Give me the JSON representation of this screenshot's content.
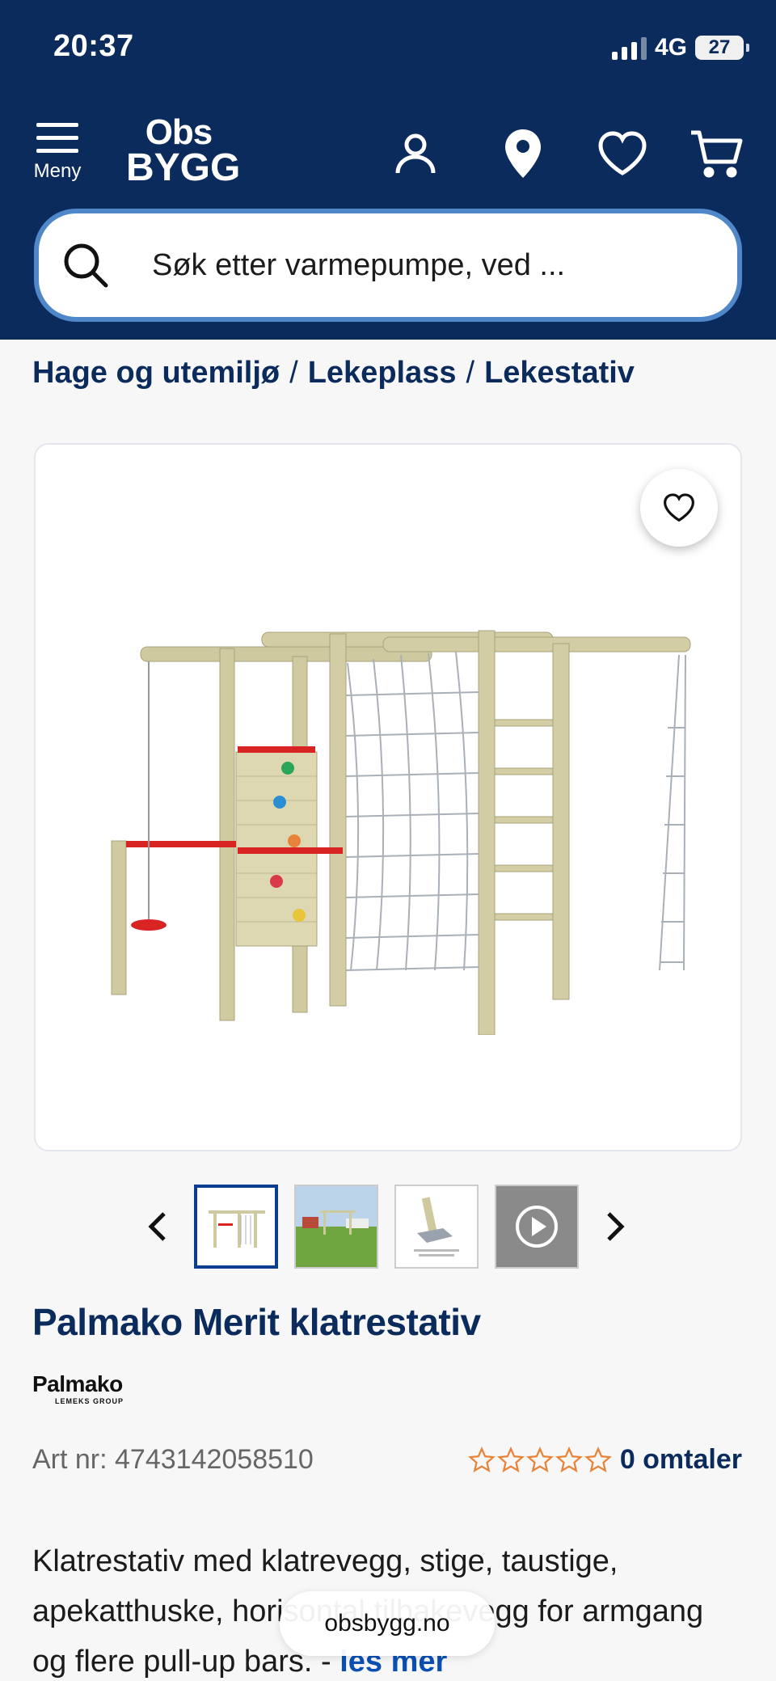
{
  "status_bar": {
    "time": "20:37",
    "network": "4G",
    "battery": "27"
  },
  "header": {
    "menu_label": "Meny",
    "logo_top": "Obs",
    "logo_bottom": "BYGG",
    "search_placeholder": "Søk etter varmepumpe, ved ..."
  },
  "breadcrumb": [
    "Hage og utemiljø",
    "Lekeplass",
    "Lekestativ"
  ],
  "product": {
    "title": "Palmako Merit klatrestativ",
    "brand_name": "Palmako",
    "brand_sub": "LEMEKS GROUP",
    "art_nr": "Art nr: 4743142058510",
    "rating_stars": 0,
    "reviews": "0 omtaler",
    "description": "Klatrestativ med klatrevegg, stige, taustige, apekatthuske, horisontal tilbakevegg for armgang og flere pull-up bars. -",
    "read_more": "les mer"
  },
  "url": "obsbygg.no",
  "colors": {
    "header_bg": "#0b2b5c",
    "accent": "#4f87c9",
    "star": "#e8843a"
  }
}
